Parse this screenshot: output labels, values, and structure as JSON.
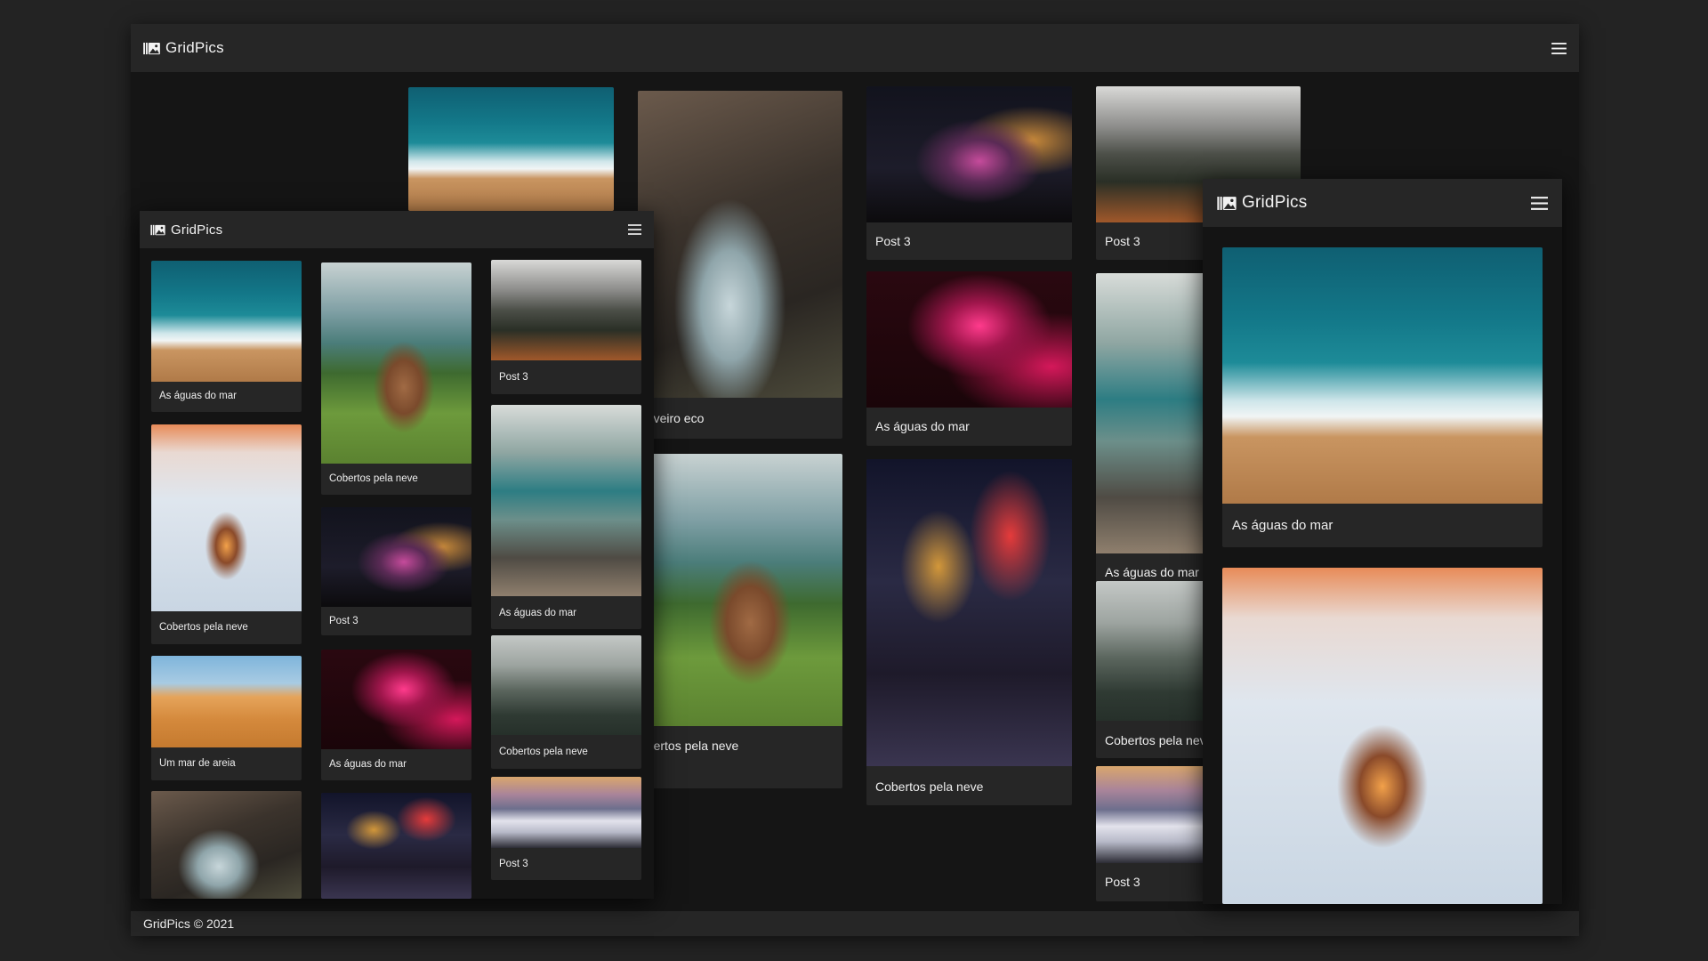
{
  "app": {
    "brand": "GridPics",
    "footer": "GridPics © 2021"
  },
  "background_grid": [
    {
      "caption": "",
      "image": "ocean-waves"
    },
    {
      "caption": "huveiro eco",
      "image": "waterfall"
    },
    {
      "caption": "Post 3",
      "image": "milky-way-arch"
    },
    {
      "caption": "Post 3",
      "image": "mountain-forest"
    },
    {
      "caption": "As águas do mar",
      "image": "neon-sign"
    },
    {
      "caption": "obertos pela neve",
      "image": "cow-on-hill"
    },
    {
      "caption": "Cobertos pela neve",
      "image": "city-night"
    },
    {
      "caption": "As águas do mar",
      "image": "mountain-lake"
    },
    {
      "caption": "Cobertos pela neve",
      "image": "foggy-forest"
    },
    {
      "caption": "Post 3",
      "image": "sea-of-clouds"
    }
  ],
  "panel_left": {
    "brand": "GridPics",
    "cards": [
      {
        "caption": "As águas do mar",
        "image": "ocean-waves"
      },
      {
        "caption": "Cobertos pela neve",
        "image": "cow-on-hill"
      },
      {
        "caption": "Post 3",
        "image": "mountain-forest"
      },
      {
        "caption": "Cobertos pela neve",
        "image": "snow-cabin"
      },
      {
        "caption": "Post 3",
        "image": "milky-way-arch"
      },
      {
        "caption": "As águas do mar",
        "image": "mountain-lake"
      },
      {
        "caption": "Um mar de areia",
        "image": "desert-dunes"
      },
      {
        "caption": "As águas do mar",
        "image": "neon-sign"
      },
      {
        "caption": "Cobertos pela neve",
        "image": "foggy-forest"
      },
      {
        "caption": "Post 3",
        "image": "sea-of-clouds"
      },
      {
        "caption": "",
        "image": "waterfall"
      },
      {
        "caption": "",
        "image": "city-night"
      }
    ]
  },
  "panel_right": {
    "brand": "GridPics",
    "cards": [
      {
        "caption": "As águas do mar",
        "image": "ocean-waves"
      },
      {
        "caption": "",
        "image": "snow-cabin"
      }
    ]
  },
  "icons": {
    "logo": "gallery-logo-icon",
    "menu": "hamburger-menu-icon"
  }
}
